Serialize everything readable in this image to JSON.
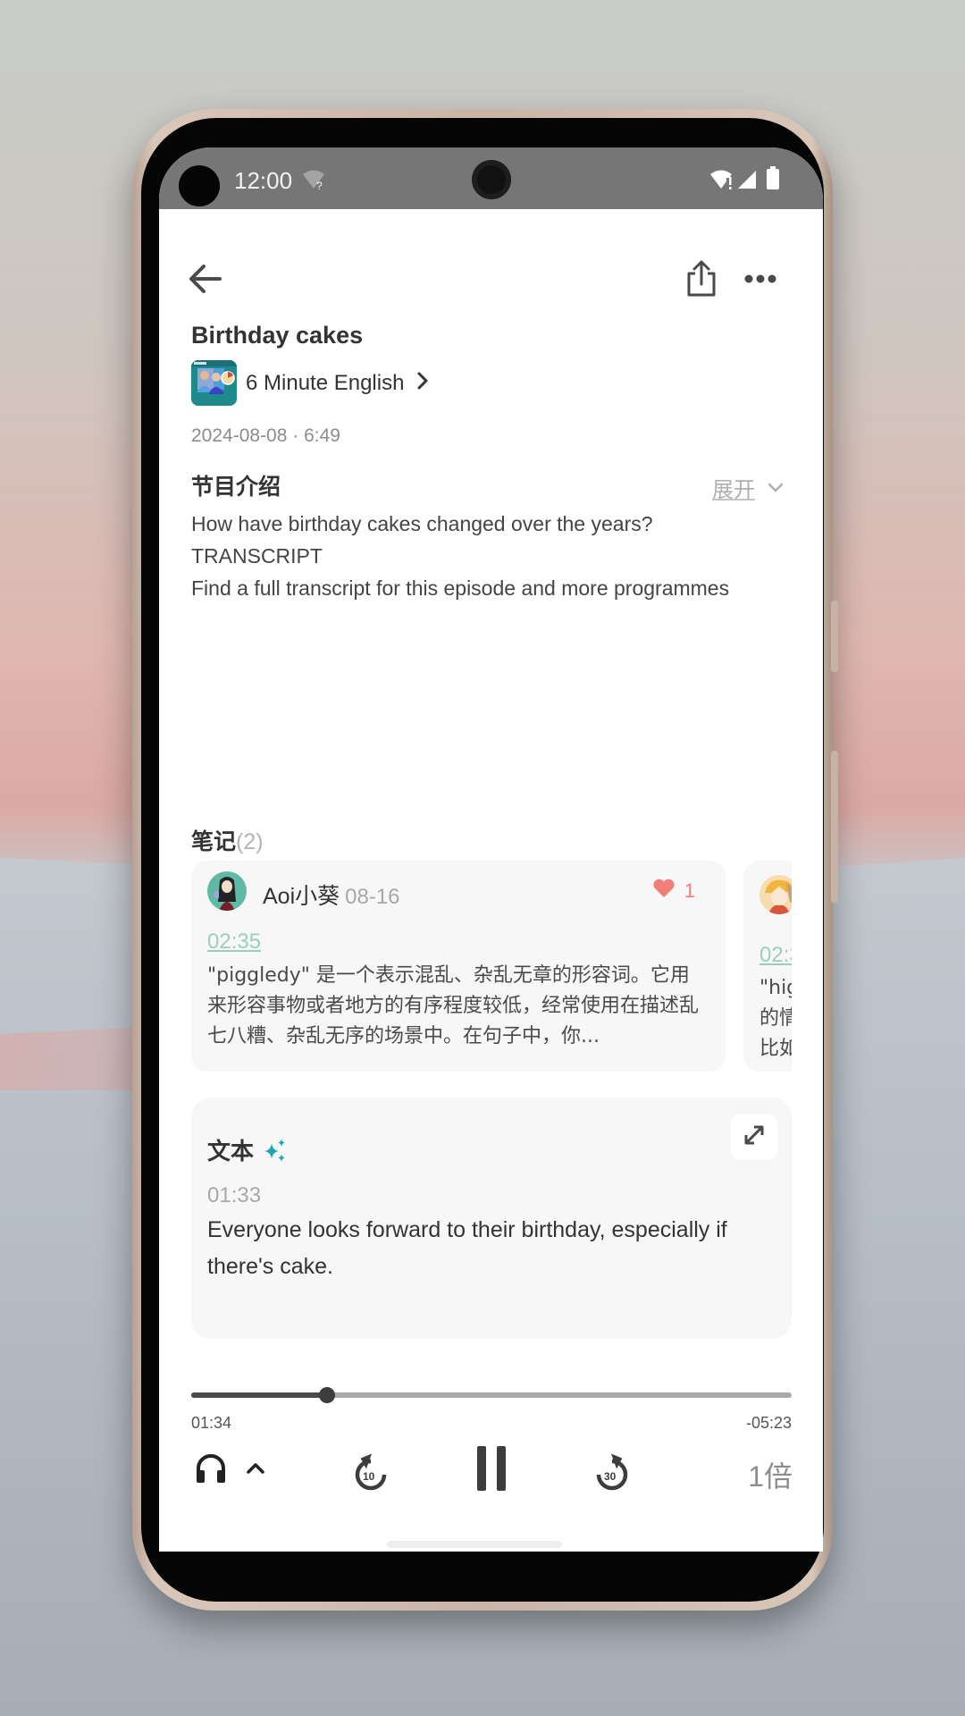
{
  "status_bar": {
    "time": "12:00",
    "icons": [
      "wifi-unknown-icon",
      "wifi-alert-icon",
      "cell-signal-icon",
      "battery-icon"
    ]
  },
  "toolbar": {
    "back_icon": "arrow-left-icon",
    "share_icon": "share-icon",
    "more_icon": "more-horizontal-icon"
  },
  "episode": {
    "title": "Birthday cakes",
    "podcast_name": "6 Minute English",
    "podcast_cover_caption": "6 Minute ENGLISH",
    "date_duration": "2024-08-08 · 6:49"
  },
  "description": {
    "heading": "节目介绍",
    "expand_label": "展开",
    "lines": [
      "How have birthday cakes changed over the years?",
      "TRANSCRIPT",
      "Find a full transcript for this episode and more programmes"
    ]
  },
  "notes": {
    "heading": "笔记",
    "count": "(2)",
    "items": [
      {
        "user": "Aoi小葵",
        "date": "08-16",
        "likes": "1",
        "timestamp": "02:35",
        "text": "\"piggledy\" 是一个表示混乱、杂乱无章的形容词。它用来形容事物或者地方的有序程度较低，经常使用在描述乱七八糟、杂乱无序的场景中。在句子中，你..."
      },
      {
        "timestamp": "02:3",
        "lines": [
          "\"hig",
          "的情",
          "比如"
        ]
      }
    ]
  },
  "transcript": {
    "heading": "文本",
    "timestamp": "01:33",
    "text": "Everyone looks forward to their birthday, especially if there's cake."
  },
  "player": {
    "elapsed": "01:34",
    "remaining": "-05:23",
    "progress_fraction": 0.2256,
    "rewind_seconds": "10",
    "forward_seconds": "30",
    "speed": "1倍"
  },
  "colors": {
    "accent_teal": "#1aa8b0",
    "timestamp_green": "#9bcfbc",
    "like_red": "#f07f7b"
  }
}
